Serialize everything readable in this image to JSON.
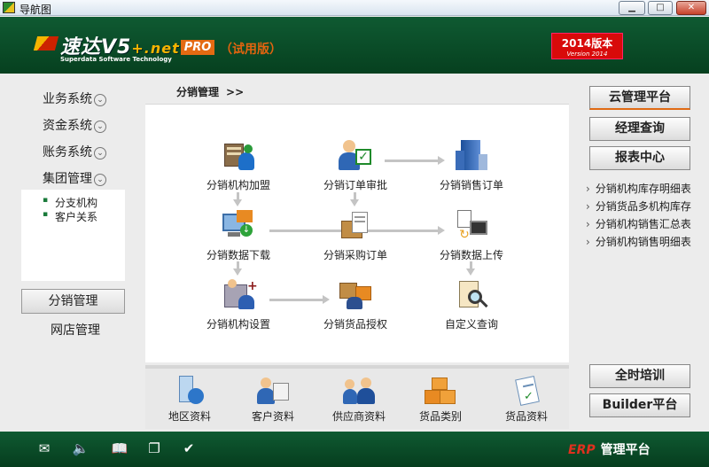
{
  "window": {
    "title": "导航图"
  },
  "header": {
    "brand_cn": "速达",
    "brand_v5": "V5",
    "brand_net": "+.net",
    "brand_sub": "Superdata Software Technology",
    "edition": "PRO",
    "trial": "（试用版）",
    "version_big": "2014版本",
    "version_small": "Version 2014"
  },
  "leftnav": {
    "items": [
      {
        "label": "业务系统"
      },
      {
        "label": "资金系统"
      },
      {
        "label": "账务系统"
      },
      {
        "label": "集团管理"
      }
    ],
    "subitems": [
      {
        "label": "分支机构"
      },
      {
        "label": "客户关系"
      }
    ],
    "active_button": "分销管理",
    "plain_item": "网店管理"
  },
  "breadcrumb": {
    "label": "分销管理",
    "arrows": ">>"
  },
  "flow": {
    "nodes": [
      {
        "label": "分销机构加盟",
        "icon": "building-people-icon"
      },
      {
        "label": "分销订单审批",
        "icon": "user-check-icon"
      },
      {
        "label": "分销销售订单",
        "icon": "office-building-icon"
      },
      {
        "label": "分销数据下载",
        "icon": "download-computer-icon"
      },
      {
        "label": "分销采购订单",
        "icon": "box-document-icon"
      },
      {
        "label": "分销数据上传",
        "icon": "upload-data-icon"
      },
      {
        "label": "分销机构设置",
        "icon": "settings-tools-icon"
      },
      {
        "label": "分销货品授权",
        "icon": "goods-authorize-icon"
      },
      {
        "label": "自定义查询",
        "icon": "magnifier-clipboard-icon"
      }
    ]
  },
  "bottom": {
    "items": [
      {
        "label": "地区资料",
        "icon": "region-globe-icon"
      },
      {
        "label": "客户资料",
        "icon": "customer-card-icon"
      },
      {
        "label": "供应商资料",
        "icon": "supplier-people-icon"
      },
      {
        "label": "货品类别",
        "icon": "goods-boxes-icon"
      },
      {
        "label": "货品资料",
        "icon": "goods-clipboard-icon"
      }
    ]
  },
  "right": {
    "buttons_top": [
      {
        "label": "云管理平台"
      },
      {
        "label": "经理查询"
      },
      {
        "label": "报表中心"
      }
    ],
    "links": [
      {
        "label": "分销机构库存明细表"
      },
      {
        "label": "分销货品多机构库存"
      },
      {
        "label": "分销机构销售汇总表"
      },
      {
        "label": "分销机构销售明细表"
      }
    ],
    "buttons_bottom": [
      {
        "label": "全时培训"
      },
      {
        "label": "Builder平台"
      }
    ]
  },
  "footer": {
    "icons": [
      "mail-icon",
      "speaker-icon",
      "book-icon",
      "copy-icon",
      "check-circle-icon"
    ],
    "erp": "ERP",
    "platform": "管理平台"
  },
  "colors": {
    "header_green": "#0f5a32",
    "accent_orange": "#e46a12",
    "badge_red": "#d80a0a"
  }
}
